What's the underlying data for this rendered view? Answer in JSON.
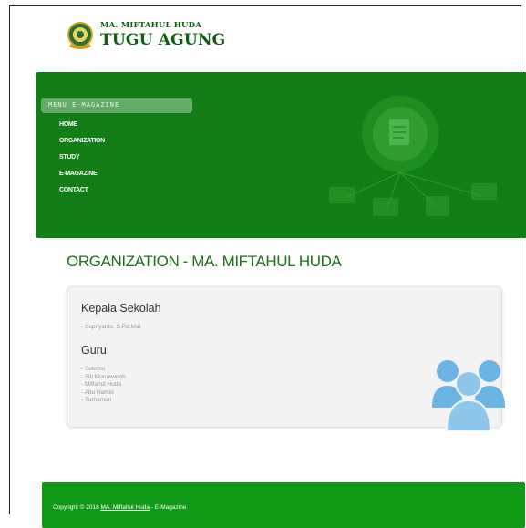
{
  "header": {
    "logo_line1": "MA. MIFTAHUL HUDA",
    "logo_line2": "TUGU AGUNG"
  },
  "menu": {
    "title": "MENU E-MAGAZINE",
    "items": [
      {
        "label": "HOME"
      },
      {
        "label": "ORGANIZATION"
      },
      {
        "label": "STUDY"
      },
      {
        "label": "E-MAGAZINE"
      },
      {
        "label": "CONTACT"
      }
    ]
  },
  "main": {
    "title": "ORGANIZATION - MA. MIFTAHUL HUDA",
    "head_title": "Kepala Sekolah",
    "head_name": "- Supriyanto, S.Pd.Mat",
    "guru_title": "Guru",
    "guru": [
      "- Sutomo",
      "- Siti Munawaroh",
      "- Miftahul Huda",
      "- Abu Hamid",
      "- Turhamun"
    ]
  },
  "footer": {
    "prefix": "Copyright © 2018 ",
    "link": "MA. Miftahul Huda",
    "suffix": " - E-Magazine"
  },
  "colors": {
    "brand_green": "#137e17",
    "footer_green": "#119a18",
    "users_icon_blue": "#6cb4e4"
  }
}
